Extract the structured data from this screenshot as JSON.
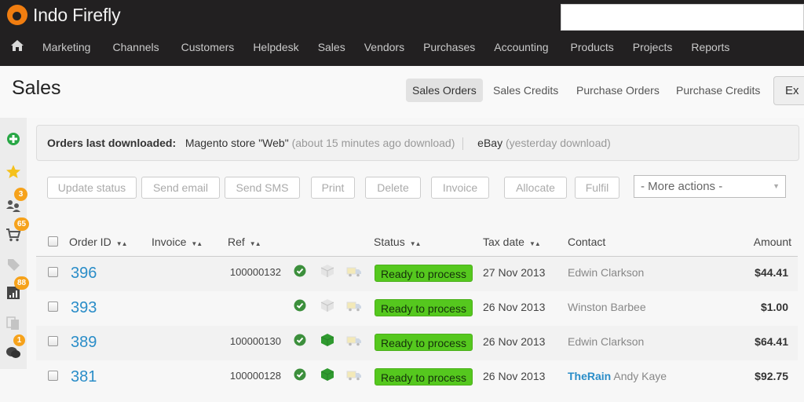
{
  "app": {
    "name": "Indo Firefly"
  },
  "search": {
    "value": ""
  },
  "nav": {
    "items": [
      {
        "label": "Marketing"
      },
      {
        "label": "Channels"
      },
      {
        "label": "Customers"
      },
      {
        "label": "Helpdesk"
      },
      {
        "label": "Sales"
      },
      {
        "label": "Vendors"
      },
      {
        "label": "Purchases"
      },
      {
        "label": "Accounting"
      },
      {
        "label": "Products"
      },
      {
        "label": "Projects"
      },
      {
        "label": "Reports"
      }
    ]
  },
  "page": {
    "title": "Sales",
    "tabs": [
      {
        "label": "Sales Orders",
        "active": true
      },
      {
        "label": "Sales Credits"
      },
      {
        "label": "Purchase Orders"
      },
      {
        "label": "Purchase Credits"
      },
      {
        "label": "Ex"
      }
    ]
  },
  "sidebar": {
    "items": [
      {
        "icon": "add-icon"
      },
      {
        "icon": "star-icon"
      },
      {
        "icon": "users-icon",
        "badge": "3"
      },
      {
        "icon": "cart-icon",
        "badge": "65"
      },
      {
        "icon": "tag-icon"
      },
      {
        "icon": "chart-icon",
        "badge": "88"
      },
      {
        "icon": "copy-icon"
      },
      {
        "icon": "chat-icon",
        "badge": "1"
      }
    ]
  },
  "info": {
    "label": "Orders last downloaded:",
    "sources": [
      {
        "name": "Magento store \"Web\"",
        "note": "(about 15 minutes ago download)"
      },
      {
        "name": "eBay",
        "note": "(yesterday download)"
      }
    ]
  },
  "actions": {
    "buttons": [
      "Update status",
      "Send email",
      "Send SMS",
      "Print",
      "Delete",
      "Invoice",
      "Allocate",
      "Fulfil"
    ],
    "more_actions": "- More actions -"
  },
  "table": {
    "columns": {
      "order_id": "Order ID",
      "invoice": "Invoice",
      "ref": "Ref",
      "status": "Status",
      "tax_date": "Tax date",
      "contact": "Contact",
      "amount": "Amount"
    },
    "rows": [
      {
        "order_id": "396",
        "ref": "100000132",
        "payment": "paid",
        "stock": "grey",
        "shipping": "pending",
        "status": "Ready to process",
        "tax_date": "27 Nov 2013",
        "company": "",
        "contact": "Edwin Clarkson",
        "amount": "$44.41"
      },
      {
        "order_id": "393",
        "ref": "",
        "payment": "paid",
        "stock": "grey",
        "shipping": "pending",
        "status": "Ready to process",
        "tax_date": "26 Nov 2013",
        "company": "",
        "contact": "Winston Barbee",
        "amount": "$1.00"
      },
      {
        "order_id": "389",
        "ref": "100000130",
        "payment": "paid",
        "stock": "green",
        "shipping": "pending",
        "status": "Ready to process",
        "tax_date": "26 Nov 2013",
        "company": "",
        "contact": "Edwin Clarkson",
        "amount": "$64.41"
      },
      {
        "order_id": "381",
        "ref": "100000128",
        "payment": "paid",
        "stock": "green",
        "shipping": "pending",
        "status": "Ready to process",
        "tax_date": "26 Nov 2013",
        "company": "TheRain",
        "contact": "Andy Kaye",
        "amount": "$92.75"
      }
    ]
  },
  "colors": {
    "brand": "#f07d10",
    "link": "#2a8dc8",
    "status_ready": "#55c81e",
    "badge": "#f6a21b"
  }
}
